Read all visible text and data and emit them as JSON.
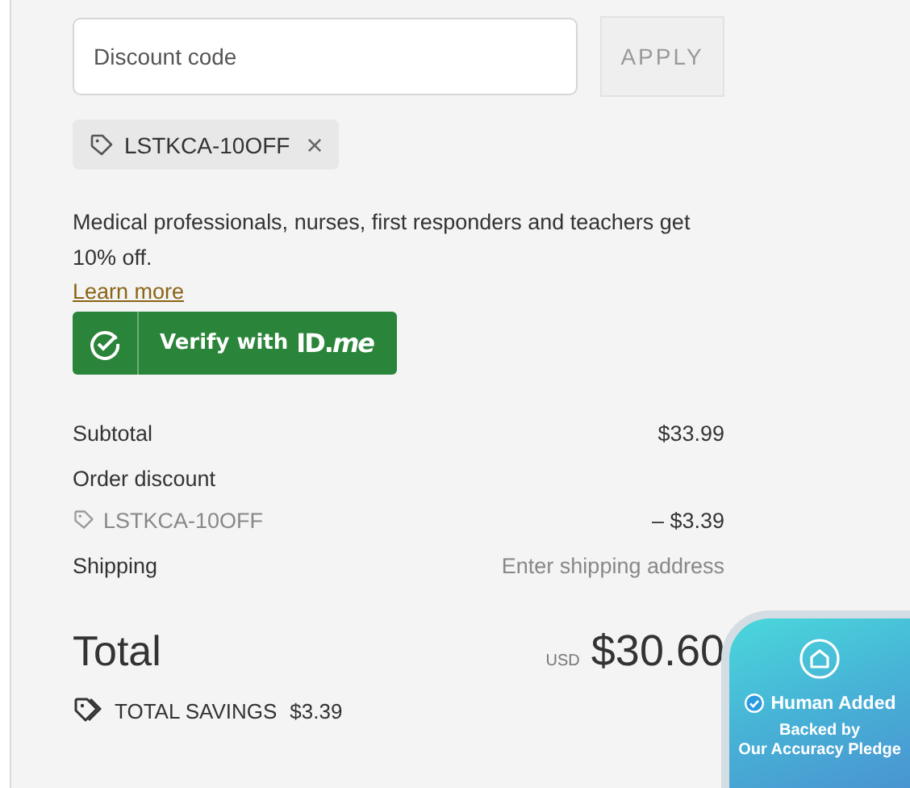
{
  "discount": {
    "placeholder": "Discount code",
    "apply_label": "APPLY",
    "applied_code": "LSTKCA-10OFF",
    "remove_label": "×"
  },
  "promo": {
    "text": "Medical professionals, nurses, first responders and teachers get 10% off.",
    "link": "Learn more",
    "button_label": "Verify with",
    "button_logo": "**ID**.*me*"
  },
  "summary": [
    {
      "label": "Subtotal",
      "value": "$33.99",
      "kind": "line"
    },
    {
      "label": "Order discount",
      "kind": "heading"
    },
    {
      "label": "LSTKCA-10OFF",
      "value": "– $3.39",
      "kind": "code"
    },
    {
      "label": "Shipping",
      "value": "Enter shipping address",
      "kind": "note"
    }
  ],
  "total": {
    "label": "Total",
    "currency": "USD",
    "value": "$30.60"
  },
  "savings": {
    "label": "TOTAL SAVINGS",
    "value": "$3.39"
  },
  "badge": {
    "title": "Human Added",
    "line_1": "Backed by",
    "line_2": "Our Accuracy Pledge"
  }
}
